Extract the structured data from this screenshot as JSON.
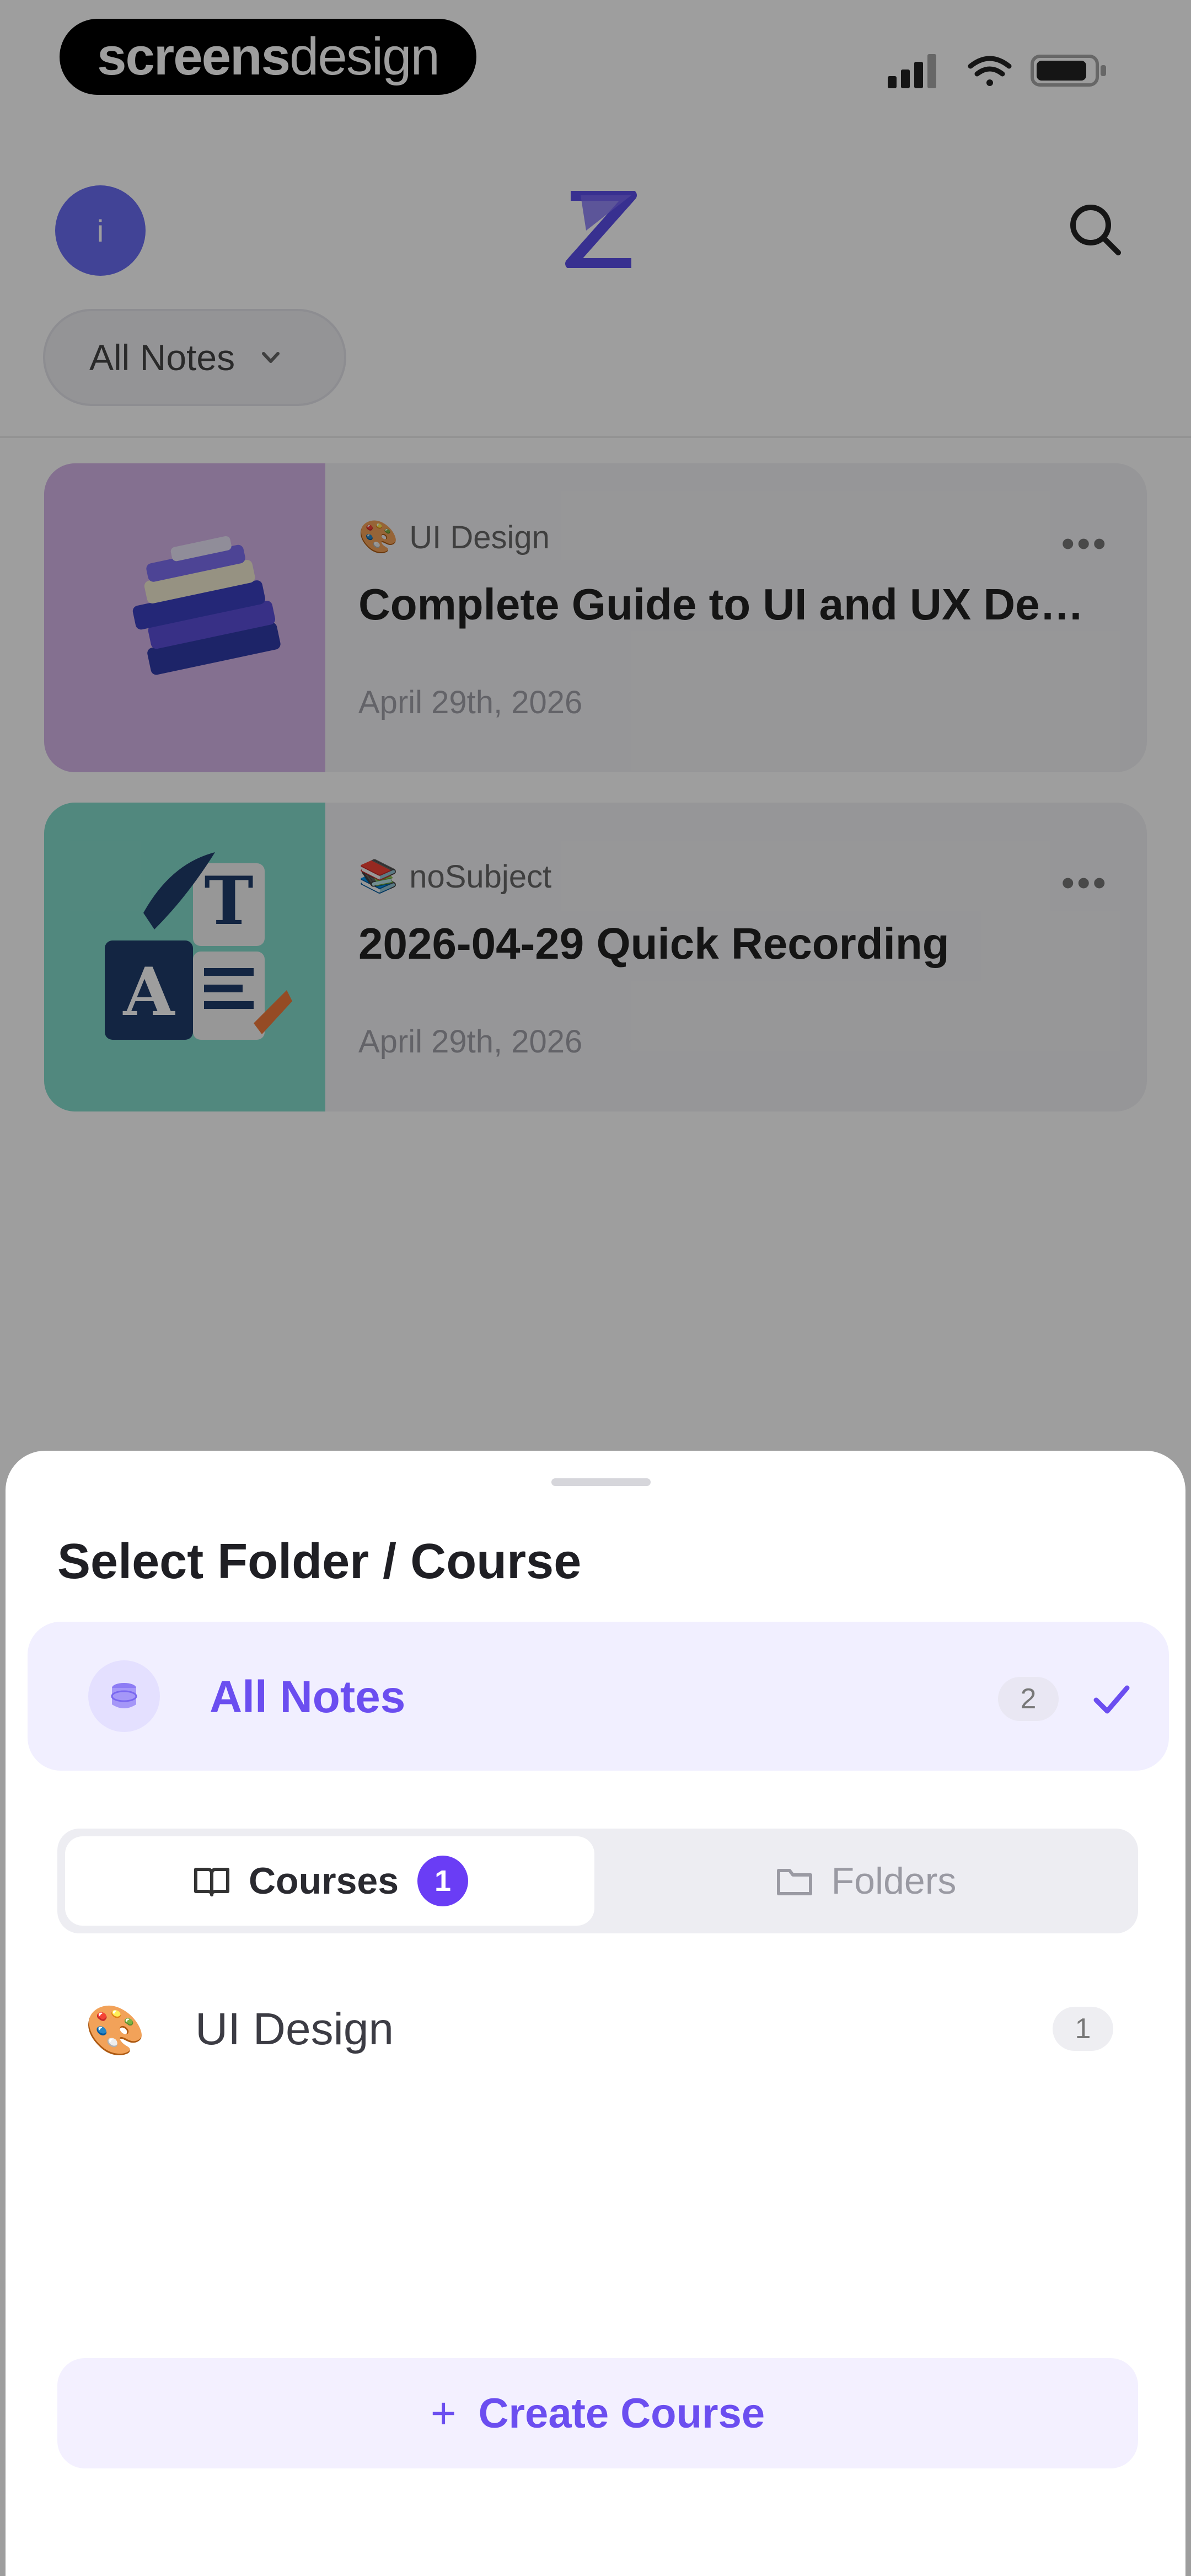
{
  "brand": {
    "part1": "screens",
    "part2": "design"
  },
  "header": {
    "avatar_initial": "i",
    "filter_label": "All Notes"
  },
  "notes": [
    {
      "subject": "UI Design",
      "subject_emoji": "🎨",
      "title": "Complete Guide to UI and UX Design Principles",
      "date": "April 29th, 2026"
    },
    {
      "subject": "noSubject",
      "subject_emoji": "📚",
      "title": "2026-04-29 Quick Recording",
      "date": "April 29th, 2026"
    }
  ],
  "sheet": {
    "title": "Select Folder / Course",
    "all_notes": {
      "label": "All Notes",
      "count": "2"
    },
    "tabs": {
      "courses_label": "Courses",
      "courses_count": "1",
      "folders_label": "Folders"
    },
    "courses": [
      {
        "emoji": "🎨",
        "label": "UI Design",
        "count": "1"
      }
    ],
    "create_label": "Create Course"
  },
  "colors": {
    "accent": "#6b4ef0",
    "accent_soft": "#f1efff",
    "avatar": "#6a6cf2",
    "card1_thumb": "#d5b5e9",
    "card2_thumb": "#84dccb"
  }
}
